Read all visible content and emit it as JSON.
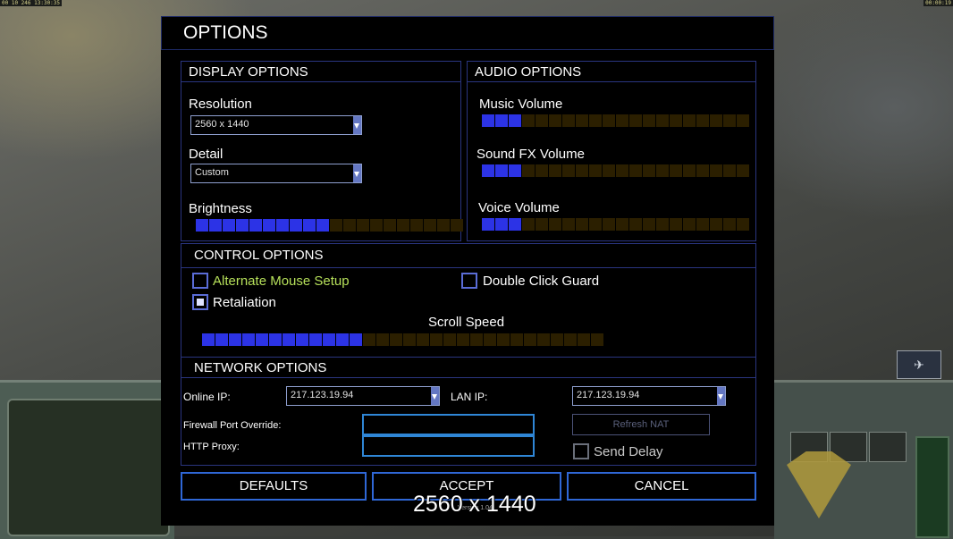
{
  "hud": {
    "top_left": "00 10 246 13:30:35",
    "top_right": "00:00:19",
    "version": "Version 1.04"
  },
  "dialog": {
    "title": "OPTIONS",
    "display": {
      "header": "DISPLAY OPTIONS",
      "resolution_label": "Resolution",
      "resolution_value": "2560 x 1440",
      "detail_label": "Detail",
      "detail_value": "Custom",
      "brightness_label": "Brightness",
      "brightness_level": 10,
      "brightness_segments": 20
    },
    "audio": {
      "header": "AUDIO OPTIONS",
      "music_label": "Music Volume",
      "music_level": 3,
      "sfx_label": "Sound FX Volume",
      "sfx_level": 3,
      "voice_label": "Voice Volume",
      "voice_level": 3,
      "segments": 20
    },
    "control": {
      "header": "CONTROL OPTIONS",
      "alt_mouse_label": "Alternate Mouse Setup",
      "alt_mouse_checked": false,
      "retaliation_label": "Retaliation",
      "retaliation_checked": true,
      "double_click_label": "Double Click Guard",
      "double_click_checked": false,
      "scroll_label": "Scroll Speed",
      "scroll_level": 12,
      "scroll_segments": 30
    },
    "network": {
      "header": "NETWORK OPTIONS",
      "online_ip_label": "Online IP:",
      "online_ip_value": "217.123.19.94",
      "lan_ip_label": "LAN IP:",
      "lan_ip_value": "217.123.19.94",
      "firewall_label": "Firewall Port Override:",
      "firewall_value": "",
      "proxy_label": "HTTP Proxy:",
      "proxy_value": "",
      "refresh_nat_label": "Refresh NAT",
      "send_delay_label": "Send Delay",
      "send_delay_checked": false
    },
    "buttons": {
      "defaults": "DEFAULTS",
      "accept": "ACCEPT",
      "cancel": "CANCEL"
    }
  },
  "overlay_resolution": "2560 x 1440",
  "colors": {
    "slider_on": "#2c33e6",
    "slider_off": "#2b1f00",
    "alt_mouse_text": "#b6e05a",
    "border": "#2a3580"
  }
}
